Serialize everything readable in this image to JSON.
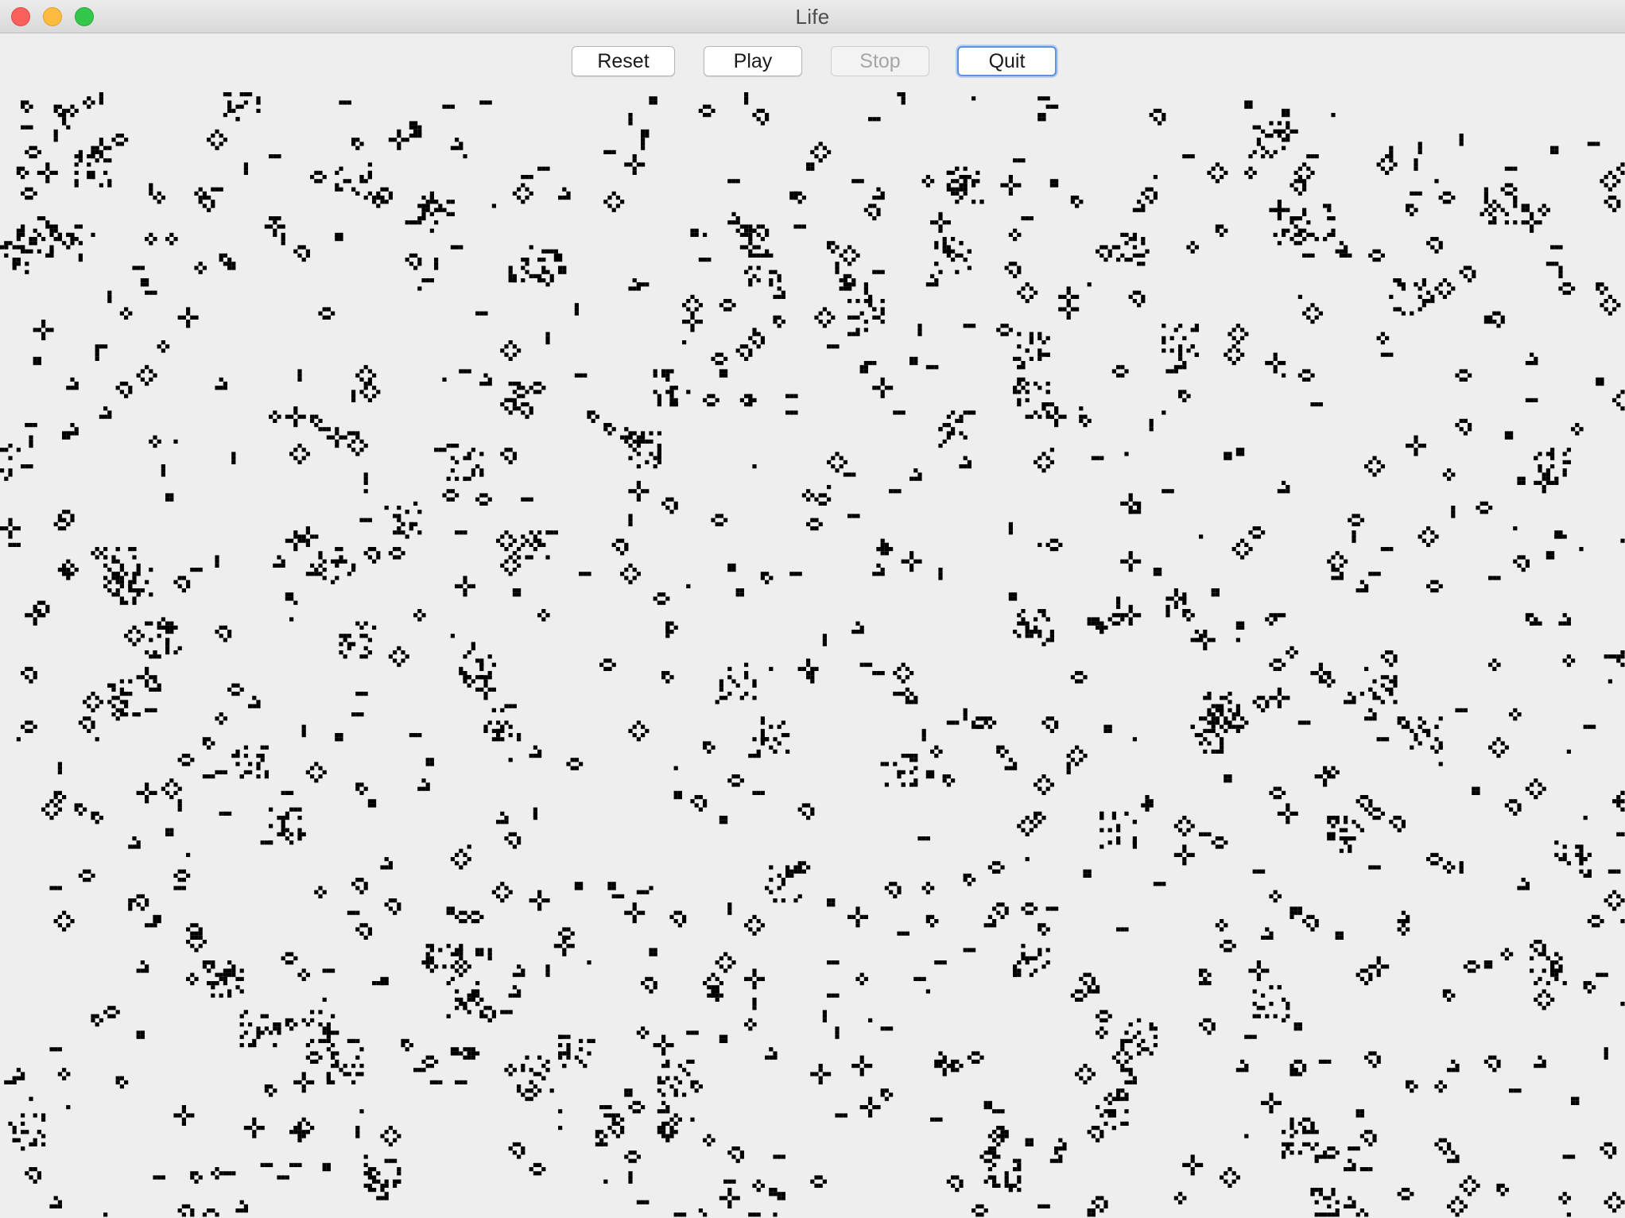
{
  "window": {
    "title": "Life"
  },
  "toolbar": {
    "reset_label": "Reset",
    "play_label": "Play",
    "stop_label": "Stop",
    "quit_label": "Quit",
    "stop_enabled": false,
    "focused_button": "Quit"
  },
  "grid": {
    "cell_color": "#000000",
    "background_color": "#eeeeee"
  },
  "colors": {
    "close": "#fc605c",
    "minimize": "#fdbc40",
    "maximize": "#34c84a",
    "focus_ring": "#5a93e6"
  }
}
